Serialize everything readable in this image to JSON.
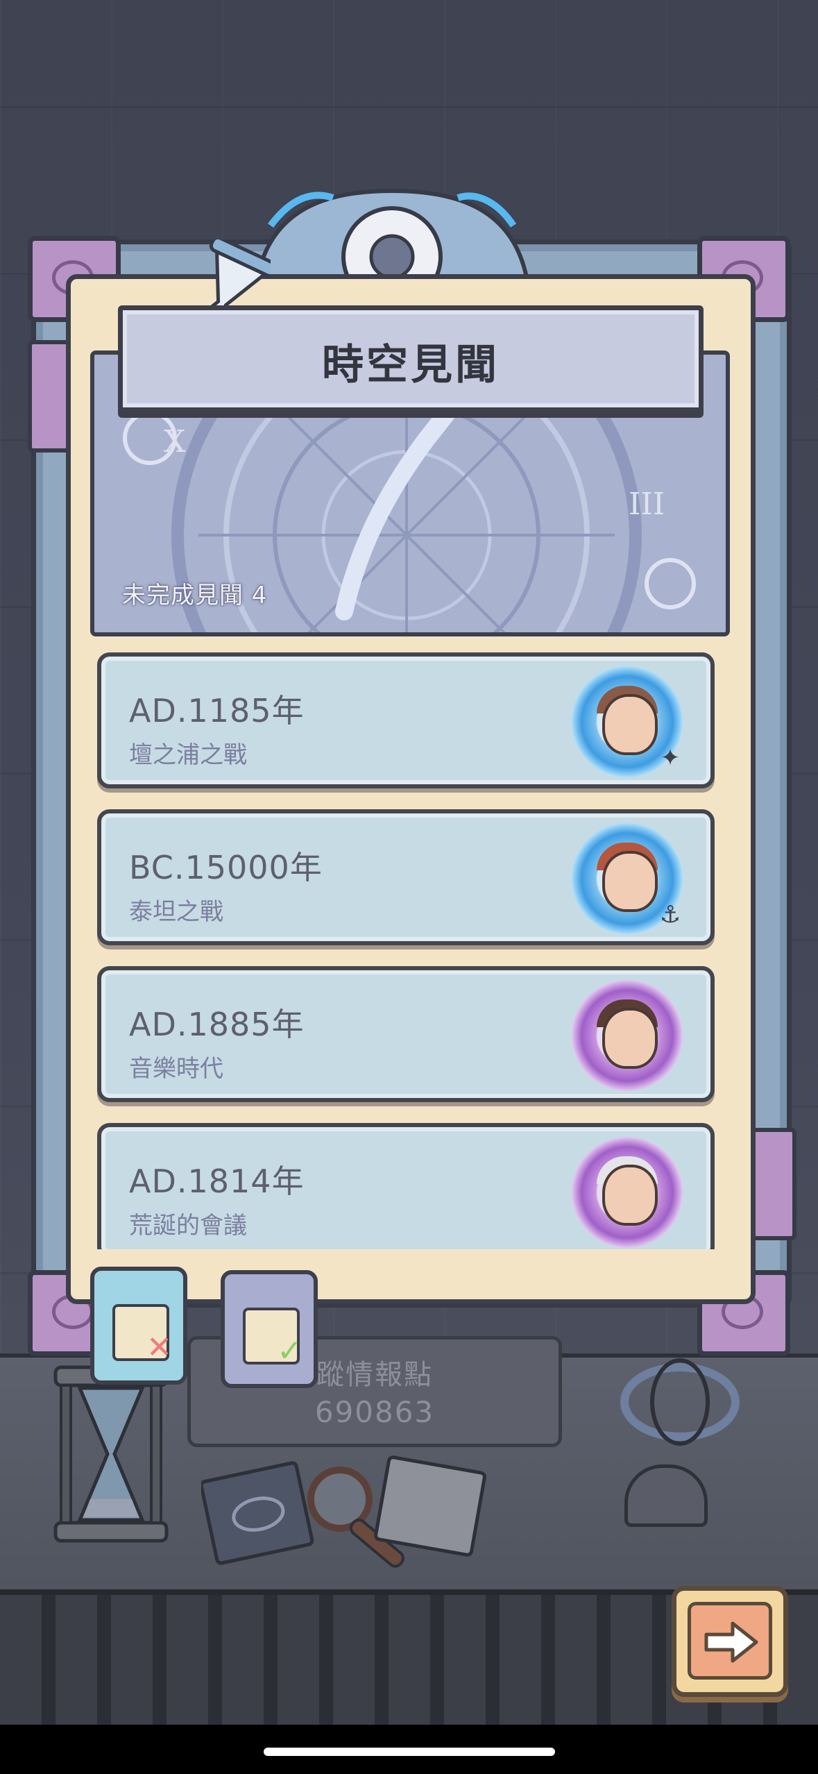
{
  "window": {
    "title": "時空見聞",
    "incomplete_label": "未完成見聞 4"
  },
  "events": [
    {
      "year": "AD.1185年",
      "name": "壇之浦之戰",
      "portal": "blue",
      "badge_icon": "shuriken-icon"
    },
    {
      "year": "BC.15000年",
      "name": "泰坦之戰",
      "portal": "blue",
      "badge_icon": "hook-icon"
    },
    {
      "year": "AD.1885年",
      "name": "音樂時代",
      "portal": "purple",
      "badge_icon": ""
    },
    {
      "year": "AD.1814年",
      "name": "荒誕的會議",
      "portal": "purple",
      "badge_icon": ""
    }
  ],
  "tabs": [
    {
      "icon": "incomplete-scroll-icon",
      "state": "selected"
    },
    {
      "icon": "completed-scroll-icon",
      "state": "unselected"
    }
  ],
  "intel": {
    "label": "蹤情報點",
    "value": "690863"
  },
  "colors": {
    "panel": "#f4e4c6",
    "card": "#c7dbe4",
    "portal_blue": "#3e9ce2",
    "portal_purple": "#a060c8",
    "frame": "#91a9c0"
  }
}
